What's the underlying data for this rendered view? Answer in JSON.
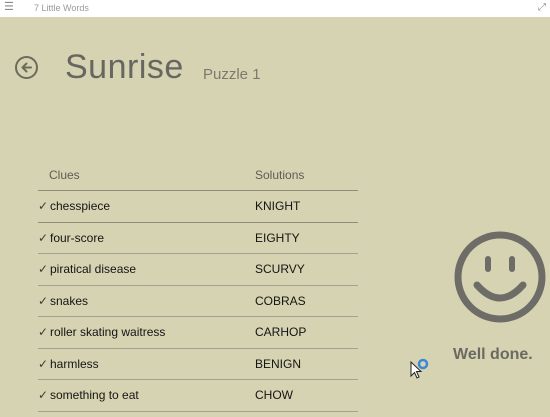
{
  "window": {
    "title": "7 Little Words",
    "menu_icon": "hamburger-icon",
    "expand_icon": "expand-icon"
  },
  "header": {
    "back_icon": "back-arrow-icon",
    "title": "Sunrise",
    "puzzle_label": "Puzzle 1"
  },
  "table": {
    "headers": {
      "clues": "Clues",
      "solutions": "Solutions"
    },
    "rows": [
      {
        "check": "✓",
        "clue": "chesspiece",
        "solution": "KNIGHT"
      },
      {
        "check": "✓",
        "clue": "four-score",
        "solution": "EIGHTY"
      },
      {
        "check": "✓",
        "clue": "piratical disease",
        "solution": "SCURVY"
      },
      {
        "check": "✓",
        "clue": "snakes",
        "solution": "COBRAS"
      },
      {
        "check": "✓",
        "clue": "roller skating waitress",
        "solution": "CARHOP"
      },
      {
        "check": "✓",
        "clue": "harmless",
        "solution": "BENIGN"
      },
      {
        "check": "✓",
        "clue": "something to eat",
        "solution": "CHOW"
      }
    ]
  },
  "result": {
    "icon": "smiley-face-icon",
    "message": "Well done."
  },
  "colors": {
    "background": "#d6d3b2",
    "title_gray": "#676660",
    "smiley_gray": "#6d6c66"
  }
}
